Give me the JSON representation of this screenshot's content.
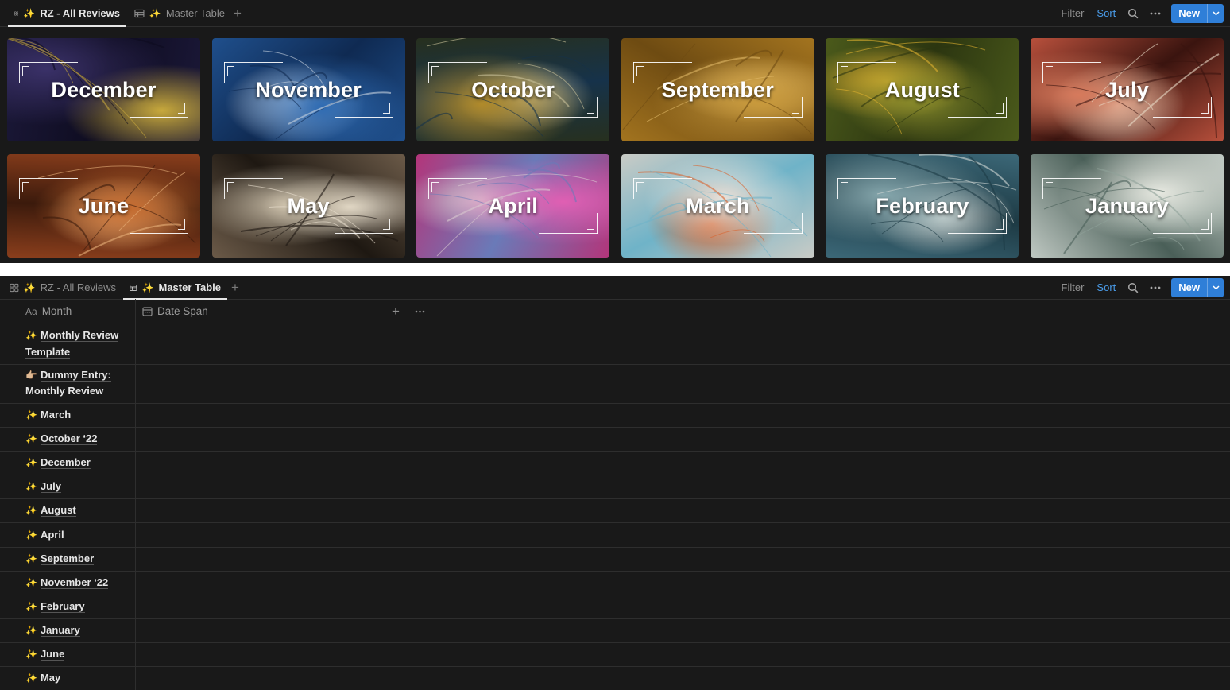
{
  "gallery_view": {
    "tabs": [
      {
        "label": "RZ - All Reviews",
        "icon": "gallery-grid-icon",
        "active": true
      },
      {
        "label": "Master Table",
        "icon": "table-icon",
        "active": false
      }
    ],
    "toolbar": {
      "filter": "Filter",
      "sort": "Sort",
      "new": "New"
    },
    "cards": [
      {
        "month": "December",
        "colors": [
          "#1b1838",
          "#3a3168",
          "#0e0c20",
          "#c8a93c"
        ]
      },
      {
        "month": "November",
        "colors": [
          "#1f4f8c",
          "#2e6bb3",
          "#0f2a52",
          "#c9d3e0"
        ]
      },
      {
        "month": "October",
        "colors": [
          "#27301e",
          "#b08a2a",
          "#16324a",
          "#c9c19a"
        ]
      },
      {
        "month": "September",
        "colors": [
          "#a3741f",
          "#c99a3c",
          "#6e4b12",
          "#e0b865"
        ]
      },
      {
        "month": "August",
        "colors": [
          "#4b5a1b",
          "#8a8d2c",
          "#2b3510",
          "#e0b02f"
        ]
      },
      {
        "month": "July",
        "colors": [
          "#b8503c",
          "#d77a5c",
          "#3a140f",
          "#e9dcc8"
        ]
      },
      {
        "month": "June",
        "colors": [
          "#8a3e1c",
          "#c46a2e",
          "#3b1a0c",
          "#e8b07a"
        ]
      },
      {
        "month": "May",
        "colors": [
          "#6b5a48",
          "#cfc3ad",
          "#1e1812",
          "#e9e0cf"
        ]
      },
      {
        "month": "April",
        "colors": [
          "#b3357a",
          "#e05fb3",
          "#6a7ab8",
          "#d9c8cf"
        ]
      },
      {
        "month": "March",
        "colors": [
          "#c9cbc6",
          "#e5e2dc",
          "#6fb3c8",
          "#d9642e"
        ]
      },
      {
        "month": "February",
        "colors": [
          "#3c6878",
          "#86a7ad",
          "#1d3a44",
          "#d2d9d6"
        ]
      },
      {
        "month": "January",
        "colors": [
          "#bfc8c2",
          "#e6e8e0",
          "#4a5f58",
          "#8fa19a"
        ]
      }
    ]
  },
  "table_view": {
    "tabs": [
      {
        "label": "RZ - All Reviews",
        "icon": "gallery-grid-icon",
        "active": false
      },
      {
        "label": "Master Table",
        "icon": "table-icon",
        "active": true
      }
    ],
    "toolbar": {
      "filter": "Filter",
      "sort": "Sort",
      "new": "New"
    },
    "columns": [
      {
        "label": "Month",
        "prefix": "Aa",
        "icon": "text-property-icon"
      },
      {
        "label": "Date Span",
        "icon": "calendar-icon"
      }
    ],
    "rows": [
      {
        "emoji": "✨",
        "title": "Monthly Review Template",
        "date_span": ""
      },
      {
        "emoji": "👉🏼",
        "title": "Dummy Entry: Monthly Review",
        "date_span": ""
      },
      {
        "emoji": "✨",
        "title": "March",
        "date_span": ""
      },
      {
        "emoji": "✨",
        "title": "October ‘22",
        "date_span": ""
      },
      {
        "emoji": "✨",
        "title": "December",
        "date_span": ""
      },
      {
        "emoji": "✨",
        "title": "July",
        "date_span": ""
      },
      {
        "emoji": "✨",
        "title": "August",
        "date_span": ""
      },
      {
        "emoji": "✨",
        "title": "April",
        "date_span": ""
      },
      {
        "emoji": "✨",
        "title": "September",
        "date_span": ""
      },
      {
        "emoji": "✨",
        "title": "November ‘22",
        "date_span": ""
      },
      {
        "emoji": "✨",
        "title": "February",
        "date_span": ""
      },
      {
        "emoji": "✨",
        "title": "January",
        "date_span": ""
      },
      {
        "emoji": "✨",
        "title": "June",
        "date_span": ""
      },
      {
        "emoji": "✨",
        "title": "May",
        "date_span": ""
      }
    ]
  }
}
